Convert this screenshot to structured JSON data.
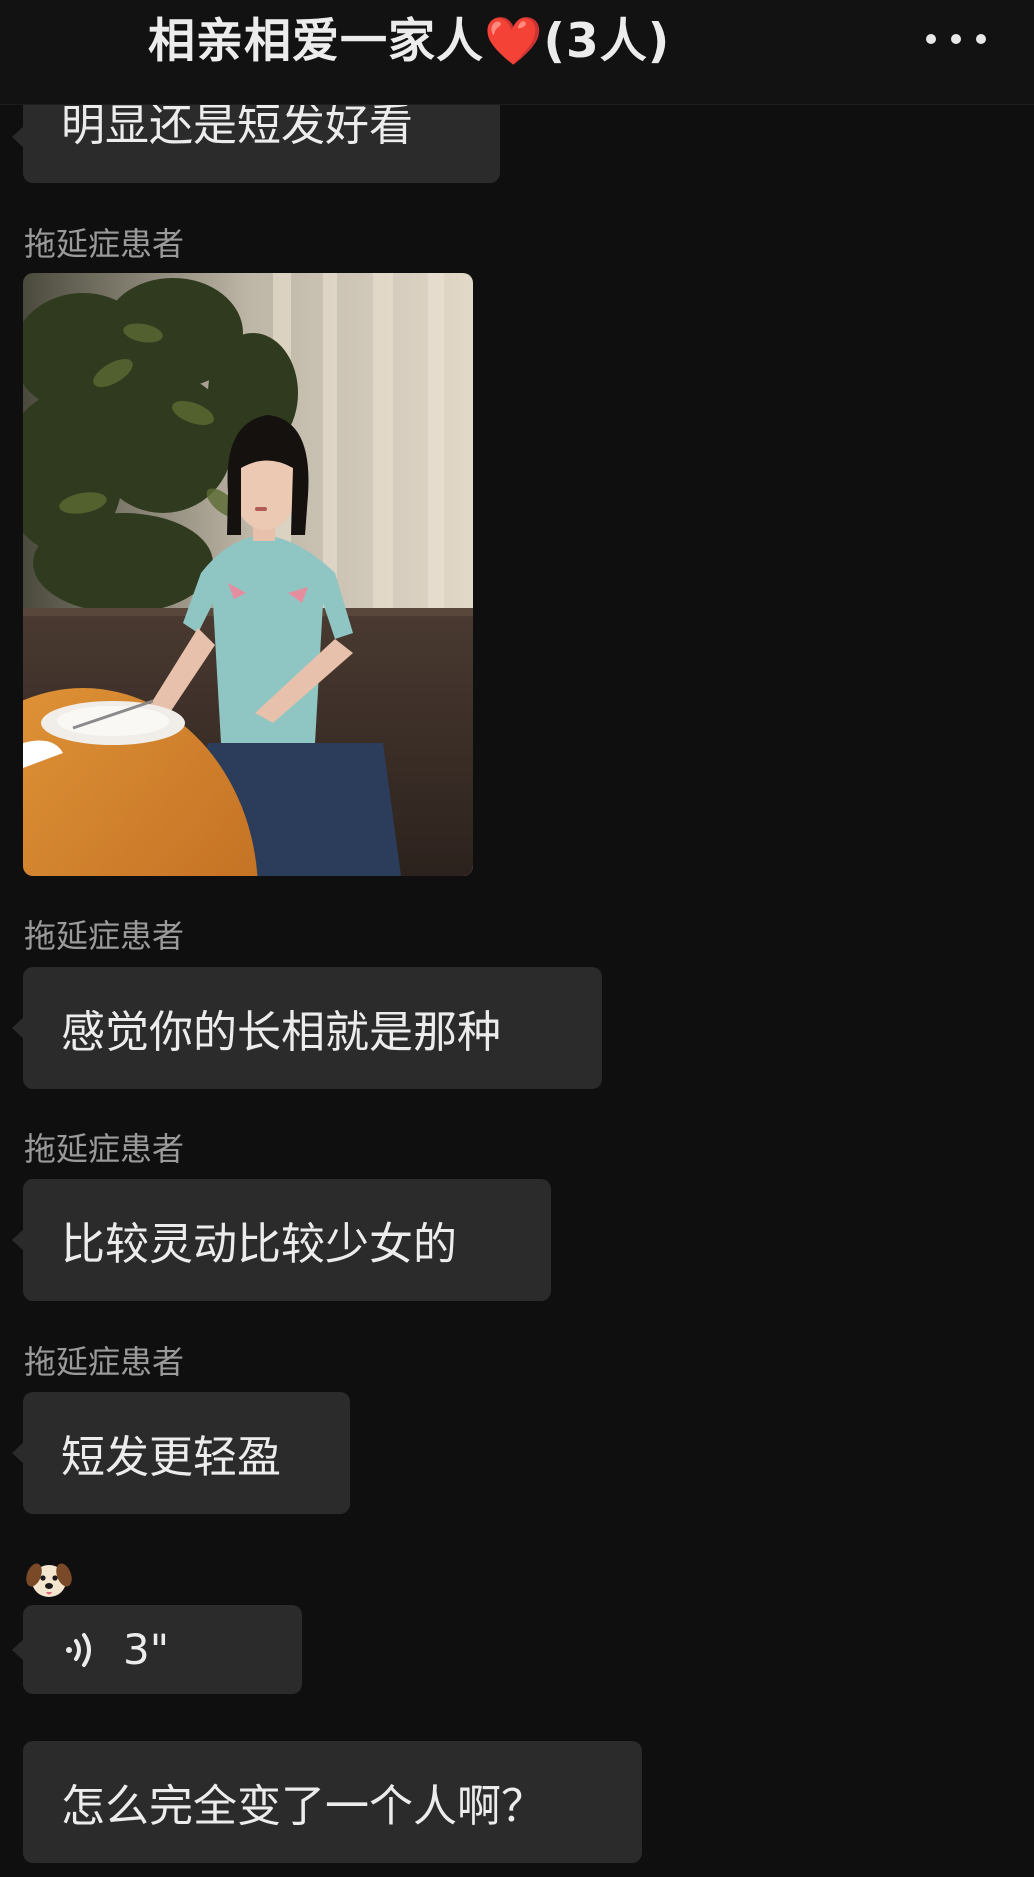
{
  "header": {
    "title": "相亲相爱一家人❤️(3人)",
    "menu_icon": "more-horizontal-icon"
  },
  "messages": [
    {
      "type": "text",
      "text": "明显还是短发好看"
    },
    {
      "type": "image",
      "sender": "拖延症患者"
    },
    {
      "type": "text",
      "sender": "拖延症患者",
      "text": "感觉你的长相就是那种"
    },
    {
      "type": "text",
      "sender": "拖延症患者",
      "text": "比较灵动比较少女的"
    },
    {
      "type": "text",
      "sender": "拖延症患者",
      "text": "短发更轻盈"
    },
    {
      "type": "voice",
      "avatar": "dog-emoji-avatar",
      "duration": "3\""
    },
    {
      "type": "text",
      "text": "怎么完全变了一个人啊？"
    }
  ],
  "colors": {
    "background": "#0f0f0f",
    "bubble": "#2b2b2b",
    "sender_text": "#9a9a9a",
    "message_text": "#ececec"
  }
}
